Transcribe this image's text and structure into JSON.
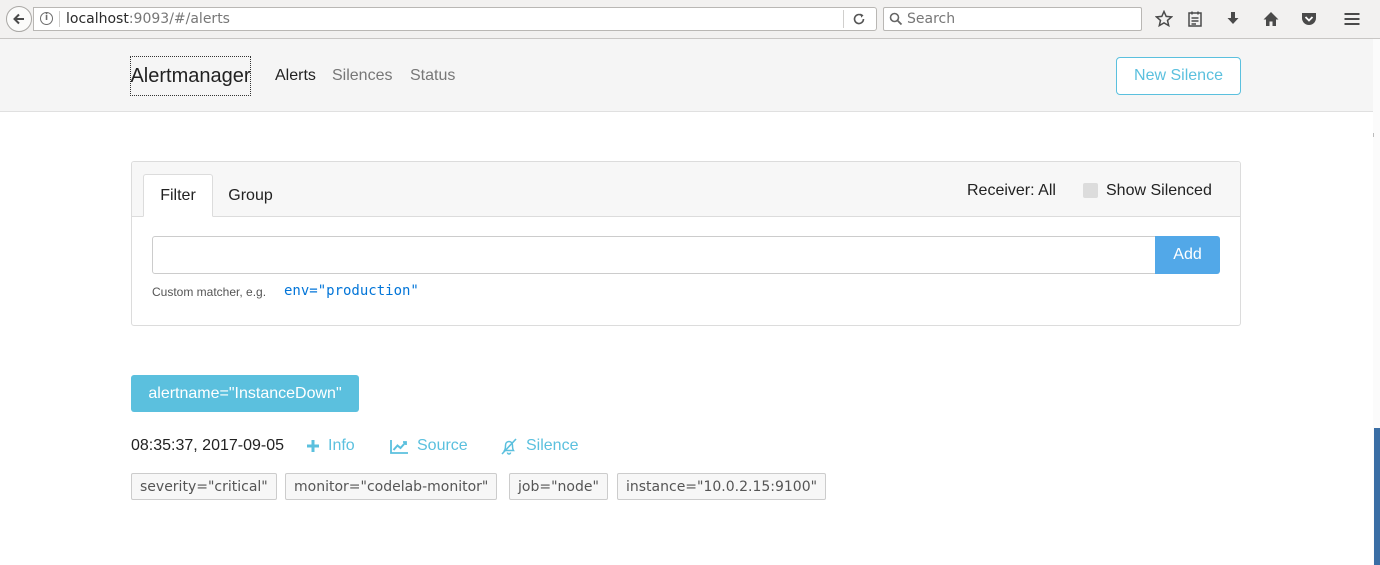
{
  "browser": {
    "url_host": "localhost",
    "url_rest": ":9093/#/alerts",
    "search_placeholder": "Search"
  },
  "navbar": {
    "brand": "Alertmanager",
    "links": [
      {
        "label": "Alerts",
        "active": true
      },
      {
        "label": "Silences",
        "active": false
      },
      {
        "label": "Status",
        "active": false
      }
    ],
    "new_silence_label": "New Silence"
  },
  "filter_card": {
    "tabs": [
      {
        "label": "Filter",
        "active": true
      },
      {
        "label": "Group",
        "active": false
      }
    ],
    "receiver_label": "Receiver: All",
    "show_silenced_label": "Show Silenced",
    "show_silenced_checked": false,
    "input_value": "",
    "add_label": "Add",
    "help_text": "Custom matcher, e.g.",
    "help_example": "env=\"production\""
  },
  "alert_group": {
    "badge": "alertname=\"InstanceDown\"",
    "alert": {
      "timestamp": "08:35:37, 2017-09-05",
      "actions": [
        {
          "label": "Info",
          "icon": "plus-icon"
        },
        {
          "label": "Source",
          "icon": "chart-line-icon"
        },
        {
          "label": "Silence",
          "icon": "bell-slash-icon"
        }
      ],
      "labels": [
        "severity=\"critical\"",
        "monitor=\"codelab-monitor\"",
        "job=\"node\"",
        "instance=\"10.0.2.15:9100\""
      ]
    }
  },
  "colors": {
    "info_accent": "#5bc0de",
    "primary": "#52a8e8",
    "link": "#0275d8"
  }
}
